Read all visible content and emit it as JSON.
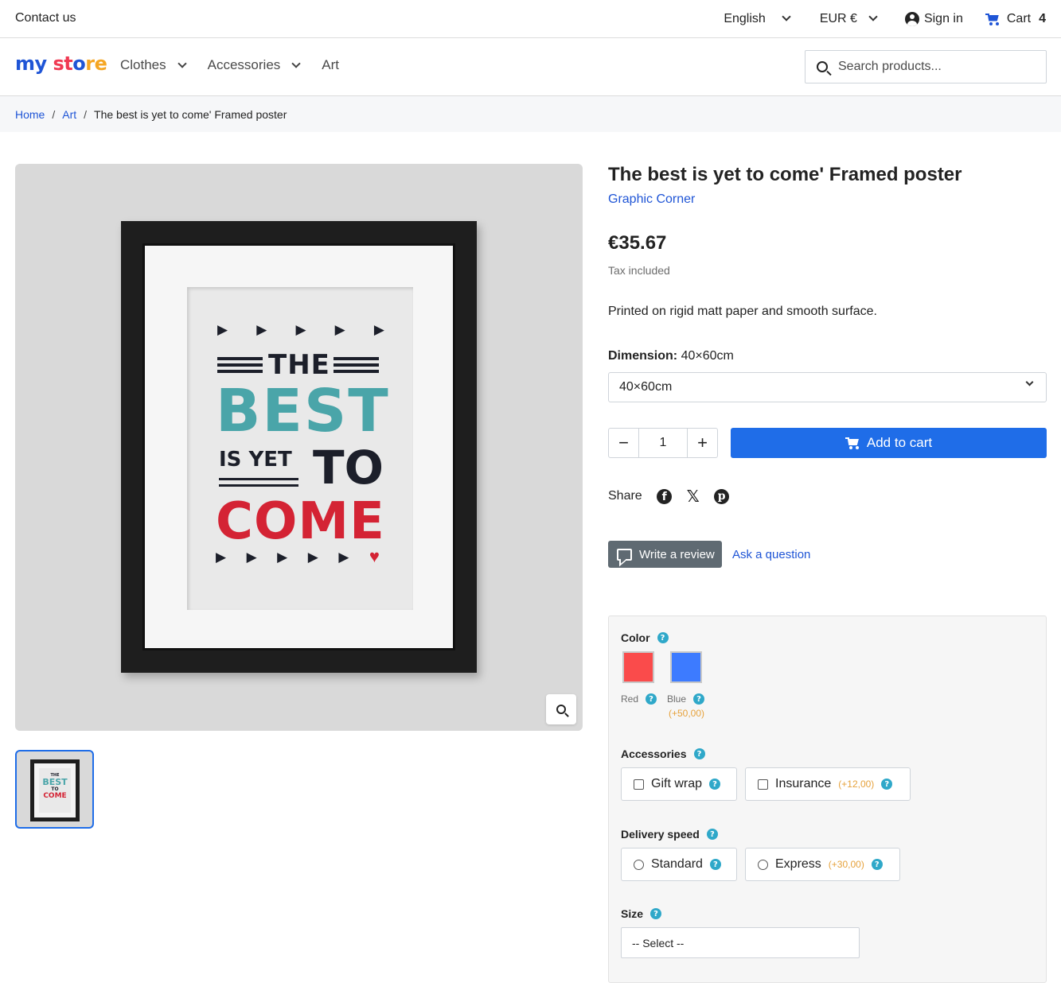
{
  "topbar": {
    "contact": "Contact us",
    "language": "English",
    "currency": "EUR €",
    "sign_in": "Sign in",
    "cart_label": "Cart",
    "cart_count": "4"
  },
  "header": {
    "logo": {
      "part1": "my",
      "part2": "st",
      "part3": "o",
      "part4": "re"
    },
    "nav": [
      {
        "label": "Clothes"
      },
      {
        "label": "Accessories"
      },
      {
        "label": "Art"
      }
    ],
    "search_placeholder": "Search products..."
  },
  "breadcrumb": {
    "items": [
      "Home",
      "Art"
    ],
    "current": "The best is yet to come' Framed poster",
    "separator": "/"
  },
  "poster": {
    "line1": "THE",
    "line2": "BEST",
    "line3": "IS YET",
    "line4": "TO",
    "line5": "COME",
    "arrow": "▶",
    "heart": "♥"
  },
  "product": {
    "title": "The best is yet to come' Framed poster",
    "brand": "Graphic Corner",
    "price": "€35.67",
    "tax_note": "Tax included",
    "description": "Printed on rigid matt paper and smooth surface.",
    "dimension_label": "Dimension:",
    "dimension_value": "40×60cm",
    "dimension_selected": "40×60cm",
    "quantity": "1",
    "qty_minus": "−",
    "qty_plus": "+",
    "add_to_cart": "Add to cart",
    "share_label": "Share",
    "write_review": "Write a review",
    "ask_question": "Ask a question"
  },
  "options": {
    "help_glyph": "?",
    "color": {
      "label": "Color",
      "swatches": [
        {
          "name": "Red",
          "hex": "#fa4b4b",
          "price": ""
        },
        {
          "name": "Blue",
          "hex": "#3d7bff",
          "price": "(+50,00)"
        }
      ]
    },
    "accessories": {
      "label": "Accessories",
      "items": [
        {
          "name": "Gift wrap",
          "price": ""
        },
        {
          "name": "Insurance",
          "price": "(+12,00)"
        }
      ]
    },
    "delivery": {
      "label": "Delivery speed",
      "items": [
        {
          "name": "Standard",
          "price": ""
        },
        {
          "name": "Express",
          "price": "(+30,00)"
        }
      ]
    },
    "size": {
      "label": "Size",
      "selected": "-- Select --"
    }
  },
  "colors": {
    "primary": "#1f6de8",
    "link": "#1f55d6",
    "help": "#2fa8c9",
    "price_add": "#e6a23c",
    "review_button": "#5f6a72"
  }
}
